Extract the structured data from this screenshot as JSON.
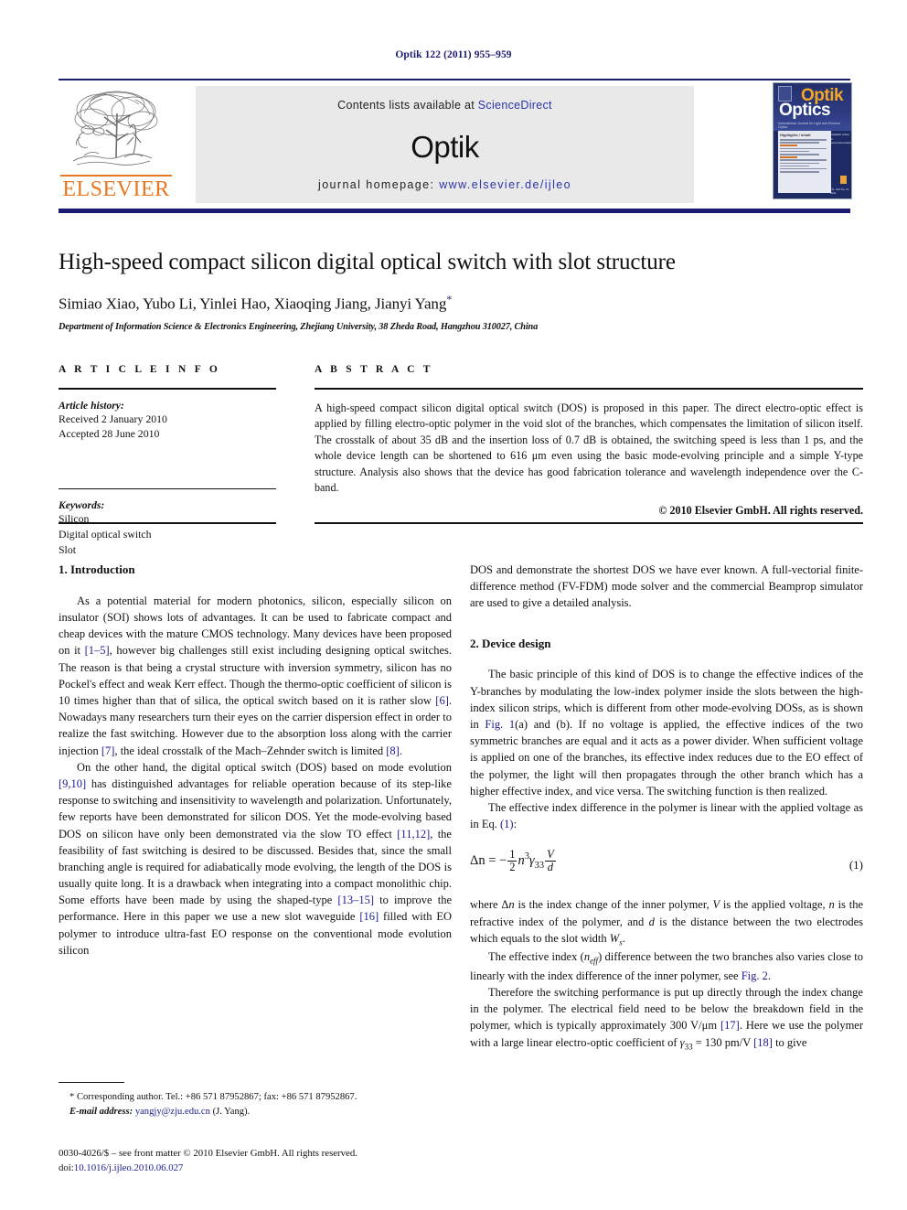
{
  "running_head": "Optik 122 (2011) 955–959",
  "masthead": {
    "contents_prefix": "Contents lists available at ",
    "sciencedirect": "ScienceDirect",
    "journal_name": "Optik",
    "homepage_label": "journal homepage: ",
    "homepage_url": "www.elsevier.de/ijleo",
    "publisher_logo_text": "ELSEVIER",
    "cover": {
      "title_top": "Optik",
      "title_bottom": "Optics",
      "subtitle": "International Journal for Light and Electron Optics",
      "panel_heading": "Highlights / Inhalt",
      "side_text": "Available online at\nwww.sciencedirect.com",
      "foot_text": "Vol. 122\nNo. 11\n2011"
    },
    "accent_orange": "#e87722",
    "accent_navy": "#1b1b6f",
    "link_blue": "#2b35a8"
  },
  "title_block": {
    "title": "High-speed compact silicon digital optical switch with slot structure",
    "authors": "Simiao Xiao, Yubo Li, Yinlei Hao, Xiaoqing Jiang, Jianyi Yang",
    "corresponding_marker": "*",
    "affiliation": "Department of Information Science & Electronics Engineering, Zhejiang University, 38 Zheda Road, Hangzhou 310027, China"
  },
  "article_info": {
    "heading": "A R T I C L E   I N F O",
    "history_label": "Article history:",
    "history_lines": [
      "Received 2 January 2010",
      "Accepted 28 June 2010"
    ],
    "keywords_label": "Keywords:",
    "keywords": [
      "Silicon",
      "Digital optical switch",
      "Slot"
    ]
  },
  "abstract": {
    "heading": "A B S T R A C T",
    "text": "A high-speed compact silicon digital optical switch (DOS) is proposed in this paper. The direct electro-optic effect is applied by filling electro-optic polymer in the void slot of the branches, which compensates the limitation of silicon itself. The crosstalk of about 35 dB and the insertion loss of 0.7 dB is obtained, the switching speed is less than 1 ps, and the whole device length can be shortened to 616 μm even using the basic mode-evolving principle and a simple Y-type structure. Analysis also shows that the device has good fabrication tolerance and wavelength independence over the C-band.",
    "copyright": "© 2010 Elsevier GmbH. All rights reserved."
  },
  "body": {
    "section1_heading": "1.  Introduction",
    "section1_para1_a": "As a potential material for modern photonics, silicon, especially silicon on insulator (SOI) shows lots of advantages. It can be used to fabricate compact and cheap devices with the mature CMOS technology. Many devices have been proposed on it ",
    "section1_para1_ref1": "[1–5]",
    "section1_para1_b": ", however big challenges still exist including designing optical switches. The reason is that being a crystal structure with inversion symmetry, silicon has no Pockel's effect and weak Kerr effect. Though the thermo-optic coefficient of silicon is 10 times higher than that of silica, the optical switch based on it is rather slow ",
    "section1_para1_ref2": "[6]",
    "section1_para1_c": ". Nowadays many researchers turn their eyes on the carrier dispersion effect in order to realize the fast switching. However due to the absorption loss along with the carrier injection ",
    "section1_para1_ref3": "[7]",
    "section1_para1_d": ", the ideal crosstalk of the Mach–Zehnder switch is limited ",
    "section1_para1_ref4": "[8]",
    "section1_para1_e": ".",
    "section1_para2_a": "On the other hand, the digital optical switch (DOS) based on mode evolution ",
    "section1_para2_ref1": "[9,10]",
    "section1_para2_b": " has distinguished advantages for reliable operation because of its step-like response to switching and insensitivity to wavelength and polarization. Unfortunately, few reports have been demonstrated for silicon DOS. Yet the mode-evolving based DOS on silicon have only been demonstrated via the slow TO effect ",
    "section1_para2_ref2": "[11,12]",
    "section1_para2_c": ", the feasibility of fast switching is desired to be discussed. Besides that, since the small branching angle is required for adiabatically mode evolving, the length of the DOS is usually quite long. It is a drawback when integrating into a compact monolithic chip. Some efforts have been made by using the shaped-type ",
    "section1_para2_ref3": "[13–15]",
    "section1_para2_d": " to improve the performance. Here in this paper we use a new slot waveguide ",
    "section1_para2_ref4": "[16]",
    "section1_para2_e": " filled with EO polymer to introduce ultra-fast EO response on the conventional mode evolution silicon DOS and demonstrate the shortest DOS we have ever known. A full-vectorial finite-difference method (FV-FDM) mode solver and the commercial Beamprop simulator are used to give a detailed analysis.",
    "section2_heading": "2.  Device design",
    "section2_para1_a": "The basic principle of this kind of DOS is to change the effective indices of the Y-branches by modulating the low-index polymer inside the slots between the high-index silicon strips, which is different from other mode-evolving DOSs, as is shown in ",
    "section2_para1_ref1": "Fig. 1",
    "section2_para1_b": "(a) and (b). If no voltage is applied, the effective indices of the two symmetric branches are equal and it acts as a power divider. When sufficient voltage is applied on one of the branches, its effective index reduces due to the EO effect of the polymer, the light will then propagates through the other branch which has a higher effective index, and vice versa. The switching function is then realized.",
    "section2_para2_a": "The effective index difference in the polymer is linear with the applied voltage as in Eq. ",
    "section2_para2_ref1": "(1)",
    "section2_para2_b": ":",
    "equation": {
      "lhs": "Δn",
      "equals": "=",
      "sign": "−",
      "frac1_num": "1",
      "frac1_den": "2",
      "n_term": "n",
      "n_exp": "3",
      "gamma": "γ",
      "gamma_sub": "33",
      "frac2_num": "V",
      "frac2_den": "d",
      "number": "(1)"
    },
    "section2_para3": "where Δn is the index change of the inner polymer, V is the applied voltage, n is the refractive index of the polymer, and d is the distance between the two electrodes which equals to the slot width Ws.",
    "section2_para4_a": "The effective index (neff) difference between the two branches also varies close to linearly with the index difference of the inner polymer, see ",
    "section2_para4_ref1": "Fig. 2",
    "section2_para4_b": ".",
    "section2_para5_a": "Therefore the switching performance is put up directly through the index change in the polymer. The electrical field need to be below the breakdown field in the polymer, which is typically approximately 300 V/μm ",
    "section2_para5_ref1": "[17]",
    "section2_para5_b": ". Here we use the polymer with a large linear electro-optic coefficient of γ33 = 130 pm/V ",
    "section2_para5_ref2": "[18]",
    "section2_para5_c": " to give"
  },
  "footnote": {
    "line1": "* Corresponding author. Tel.: +86 571 87952867; fax: +86 571 87952867.",
    "email_label": "E-mail address:",
    "email": "yangjy@zju.edu.cn",
    "email_suffix": "(J. Yang)."
  },
  "bottom_matter": {
    "line1": "0030-4026/$ – see front matter © 2010 Elsevier GmbH. All rights reserved.",
    "doi_label": "doi:",
    "doi_value": "10.1016/j.ijleo.2010.06.027"
  }
}
